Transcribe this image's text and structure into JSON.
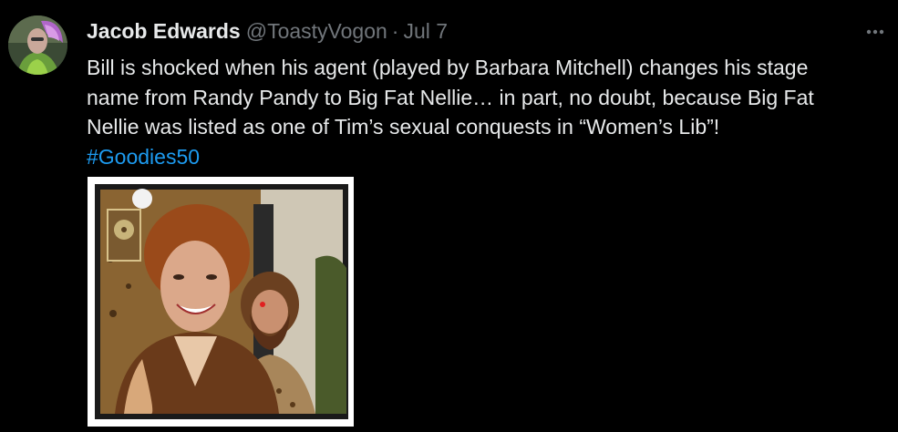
{
  "tweet": {
    "display_name": "Jacob Edwards",
    "handle": "@ToastyVogon",
    "separator": "·",
    "date": "Jul 7",
    "more_icon": "more-horizontal-icon",
    "text_lines": [
      "Bill is shocked when his agent (played by Barbara Mitchell) changes his stage",
      "name from Randy Pandy to Big Fat Nellie… in part, no doubt, because Big Fat",
      "Nellie was listed as one of Tim’s sexual conquests in “Women’s Lib”!"
    ],
    "hashtag": "#Goodies50"
  },
  "colors": {
    "background": "#000000",
    "primary_text": "#e7e9ea",
    "secondary_text": "#71767b",
    "link": "#1d9bf0"
  }
}
